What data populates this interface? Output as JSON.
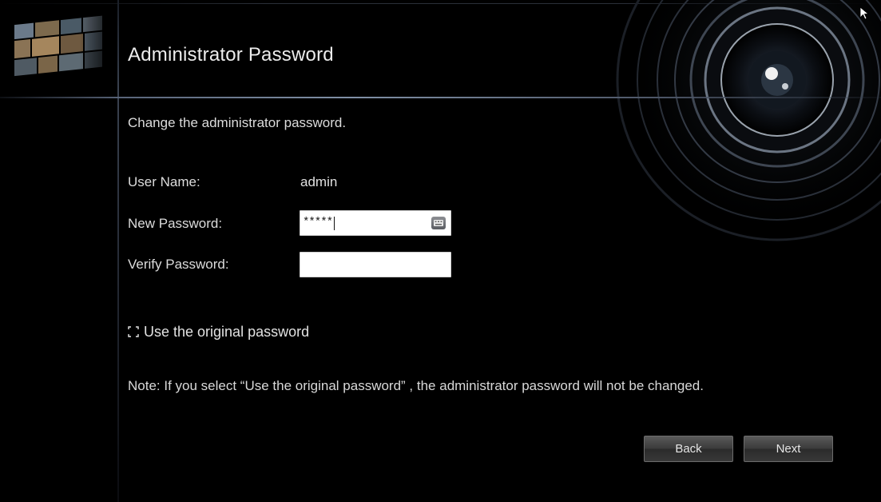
{
  "header": {
    "title": "Administrator Password"
  },
  "main": {
    "description": "Change the administrator password.",
    "username": {
      "label": "User Name:",
      "value": "admin"
    },
    "new_password": {
      "label": "New Password:",
      "masked_value": "*****",
      "keyboard_icon": "keyboard-icon"
    },
    "verify_password": {
      "label": "Verify Password:",
      "masked_value": ""
    },
    "use_original": {
      "label": "Use the original password",
      "checked": false
    },
    "note": "Note: If you select “Use the original password” , the administrator password will not be changed."
  },
  "footer": {
    "back_label": "Back",
    "next_label": "Next"
  },
  "colors": {
    "background": "#000000",
    "text": "#e6e6e6",
    "separator": "#8090a6",
    "button": "#3b3b3b"
  }
}
